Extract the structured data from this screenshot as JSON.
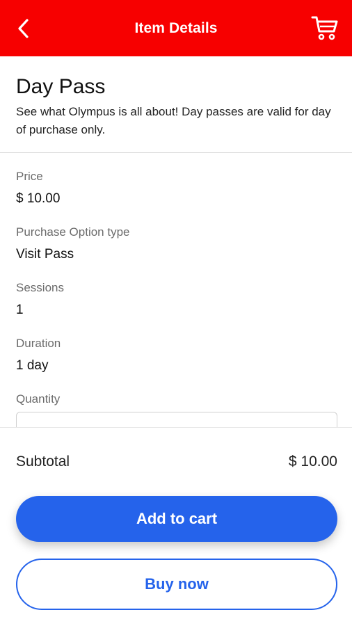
{
  "topbar": {
    "title": "Item Details",
    "back_icon": "chevron-left-icon",
    "cart_icon": "shopping-cart-icon",
    "background_color": "#f70000"
  },
  "item": {
    "name": "Day Pass",
    "description": "See what Olympus is all about! Day passes are valid for day of purchase only."
  },
  "details": {
    "price_label": "Price",
    "price_value": "$ 10.00",
    "option_label": "Purchase Option type",
    "option_value": "Visit Pass",
    "sessions_label": "Sessions",
    "sessions_value": "1",
    "duration_label": "Duration",
    "duration_value": "1 day",
    "quantity_label": "Quantity",
    "quantity_value": ""
  },
  "footer": {
    "subtotal_label": "Subtotal",
    "subtotal_value": "$ 10.00",
    "add_to_cart_label": "Add to cart",
    "buy_now_label": "Buy now",
    "accent_color": "#2563eb"
  }
}
